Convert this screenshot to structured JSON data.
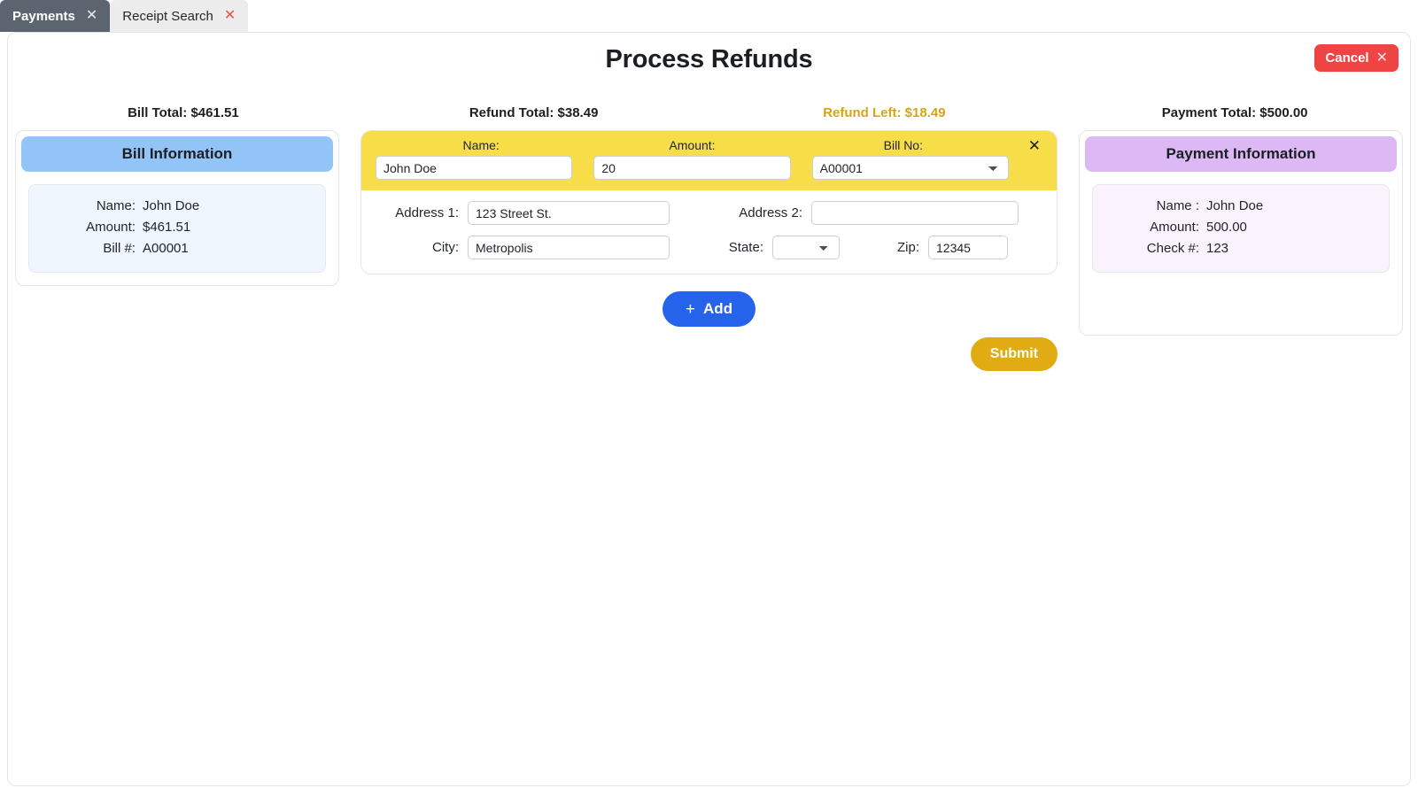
{
  "tabs": [
    {
      "label": "Payments",
      "close_icon": "close-icon",
      "active": true
    },
    {
      "label": "Receipt Search",
      "close_icon": "close-icon",
      "active": false
    }
  ],
  "header": {
    "title": "Process Refunds",
    "cancel_label": "Cancel",
    "cancel_icon": "×"
  },
  "totals": {
    "bill_total": "Bill Total: $461.51",
    "refund_total": "Refund Total: $38.49",
    "refund_left": "Refund Left: $18.49",
    "payment_total": "Payment Total: $500.00",
    "refund_left_color": "#d8a413"
  },
  "bill_information": {
    "heading": "Bill Information",
    "heading_color": "#93c4f8",
    "rows": [
      {
        "label": "Name:",
        "value": "John Doe"
      },
      {
        "label": "Amount:",
        "value": "$461.51"
      },
      {
        "label": "Bill #:",
        "value": "A00001"
      }
    ]
  },
  "payment_information": {
    "heading": "Payment Information",
    "heading_color": "#dcb8f5",
    "rows": [
      {
        "label": "Name :",
        "value": "John Doe"
      },
      {
        "label": "Amount:",
        "value": "500.00"
      },
      {
        "label": "Check #:",
        "value": "123"
      }
    ]
  },
  "refund_row": {
    "accent_color": "#f7de48",
    "close_icon": "×",
    "name_label": "Name:",
    "name_value": "John Doe",
    "name_placeholder": "",
    "amount_label": "Amount:",
    "amount_value": "20",
    "amount_placeholder": "",
    "billno_label": "Bill No:",
    "billno_value": "A00001",
    "billno_options": [
      "A00001"
    ],
    "address1_label": "Address 1:",
    "address1_value": "123 Street St.",
    "address1_placeholder": "",
    "address2_label": "Address 2:",
    "address2_value": "",
    "address2_placeholder": "",
    "city_label": "City:",
    "city_value": "Metropolis",
    "city_placeholder": "",
    "state_label": "State:",
    "state_value": "",
    "state_options": [
      ""
    ],
    "zip_label": "Zip:",
    "zip_value": "12345",
    "zip_placeholder": ""
  },
  "actions": {
    "add_label": "Add",
    "add_plus_icon": "+",
    "add_color": "#2563eb",
    "submit_label": "Submit",
    "submit_color": "#e0ab13"
  }
}
